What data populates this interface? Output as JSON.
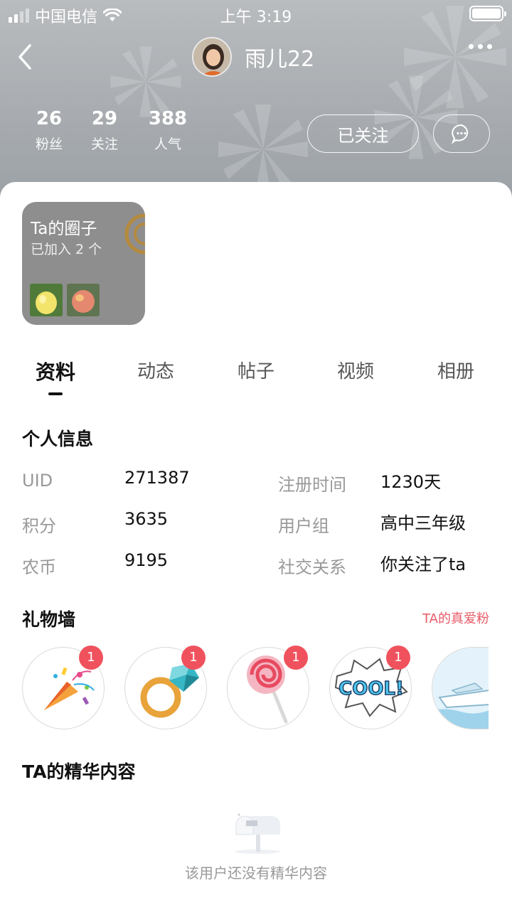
{
  "status_bar": {
    "carrier": "中国电信",
    "time": "上午 3:19"
  },
  "header": {
    "username": "雨儿22",
    "stats": [
      {
        "value": "26",
        "label": "粉丝"
      },
      {
        "value": "29",
        "label": "关注"
      },
      {
        "value": "388",
        "label": "人气"
      }
    ],
    "follow_button": "已关注"
  },
  "circle": {
    "title": "Ta的圈子",
    "subtitle": "已加入 2 个"
  },
  "tabs": [
    {
      "label": "资料"
    },
    {
      "label": "动态"
    },
    {
      "label": "帖子"
    },
    {
      "label": "视频"
    },
    {
      "label": "相册"
    }
  ],
  "profile": {
    "title": "个人信息",
    "rows": [
      {
        "label": "UID",
        "value": "271387"
      },
      {
        "label": "注册时间",
        "value": "1230天"
      },
      {
        "label": "积分",
        "value": "3635"
      },
      {
        "label": "用户组",
        "value": "高中三年级"
      },
      {
        "label": "农币",
        "value": "9195"
      },
      {
        "label": "社交关系",
        "value": "你关注了ta"
      }
    ]
  },
  "gifts": {
    "title": "礼物墙",
    "link": "TA的真爱粉",
    "items": [
      {
        "icon": "party-popper-icon",
        "count": "1"
      },
      {
        "icon": "diamond-ring-icon",
        "count": "1"
      },
      {
        "icon": "lollipop-icon",
        "count": "1"
      },
      {
        "icon": "cool-sticker-icon",
        "count": "1"
      },
      {
        "icon": "yacht-icon"
      }
    ]
  },
  "featured": {
    "title": "TA的精华内容",
    "empty_text": "该用户还没有精华内容"
  },
  "colors": {
    "accent_red": "#e85a67",
    "badge_red": "#f0525d",
    "circle_card_bg": "#8f8e8e"
  }
}
